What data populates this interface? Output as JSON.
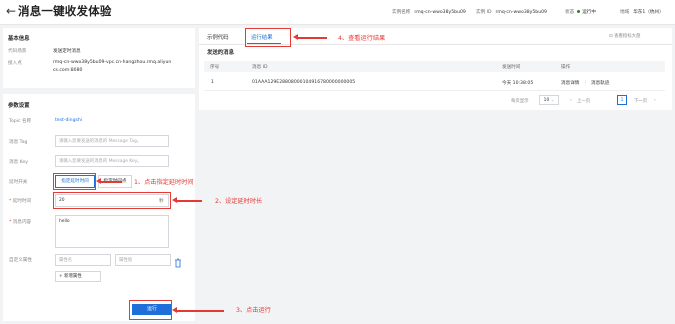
{
  "header": {
    "back_icon": "back-arrow-icon",
    "title": "消息一键收发体验",
    "instance_name_label": "实例名称",
    "instance_name": "rmq-cn-wwo38y5bu09",
    "instance_id_label": "实例 ID",
    "instance_id": "rmq-cn-wwo38y5bu09",
    "status_label": "状态",
    "status": "运行中",
    "region_label": "地域",
    "region": "华东1（杭州）"
  },
  "basic_info": {
    "title": "基本信息",
    "scene_label": "代码场景",
    "scene_value": "发送定时消息",
    "endpoint_label": "接入点",
    "endpoint_value_line1": "rmq-cn-wwo38y5bu09-vpc.cn-hangzhou.rmq.aliyun",
    "endpoint_value_line2": "cs.com:8080"
  },
  "params": {
    "title": "参数设置",
    "topic_label": "Topic 名称",
    "topic_value": "test-dingshi",
    "tag_label": "消息 Tag",
    "tag_placeholder": "请输入您要发送的消息的 Message Tag。",
    "key_label": "消息 Key",
    "key_placeholder": "请输入您要发送的消息的 Message Key。",
    "delay_switch_label": "延时开关",
    "seg_delay": "指定延时时间",
    "seg_timed": "指定时间点",
    "delay_time_label": "延时时间",
    "delay_time_value": "20",
    "delay_unit": "秒",
    "content_label": "消息内容",
    "content_value": "hello",
    "custom_attr_label": "自定义属性",
    "attr_name_placeholder": "属性名",
    "attr_value_placeholder": "属性值",
    "delete_icon": "trash-icon",
    "add_attr_label": "新增属性",
    "add_icon": "plus-icon",
    "run_label": "运行"
  },
  "results": {
    "tab_sample_code": "示例代码",
    "tab_run_result": "运行结果",
    "view_metrics_label": "查看指标大盘",
    "view_metrics_icon": "chart-icon",
    "sent_title": "发送的消息",
    "columns": [
      "序号",
      "消息 ID",
      "发送时间",
      "操作"
    ],
    "rows": [
      {
        "index": "1",
        "message_id": "01AAA129E28808000104916780000000005",
        "send_time": "今天 10:38:05",
        "op_detail": "消息详情",
        "op_trace": "消息轨迹"
      }
    ],
    "page_size_label": "每页显示",
    "page_size": "10",
    "page_size_icon": "chevron-down-icon",
    "prev_label": "上一页",
    "current_page": "1",
    "next_label": "下一页",
    "page_prefix_icon": "chevron-left-icon",
    "page_suffix_icon": "chevron-right-icon"
  },
  "annotations": {
    "step1": "1、点击指定延时时间",
    "step2": "2、设定延时时长",
    "step3": "3、点击运行",
    "step4": "4、查看运行结果"
  }
}
